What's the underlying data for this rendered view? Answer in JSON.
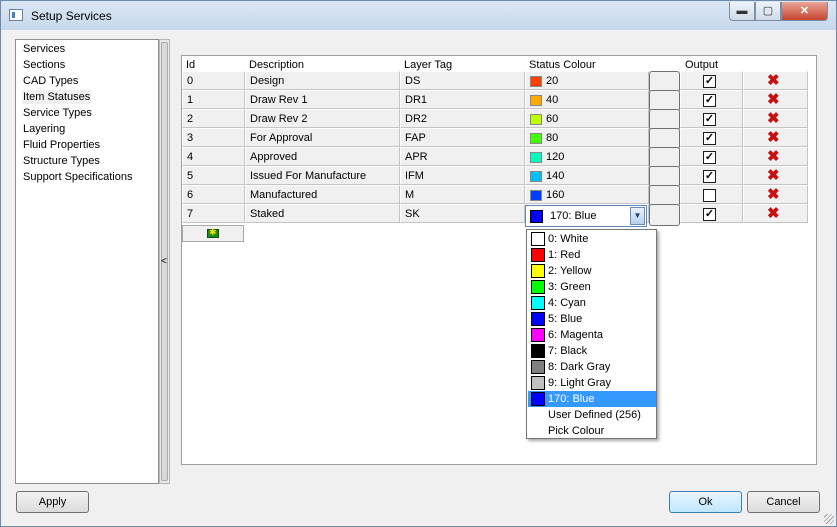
{
  "window": {
    "title": "Setup Services",
    "minimize_glyph": "▬",
    "maximize_glyph": "▢",
    "close_glyph": "✕"
  },
  "nav": {
    "items": [
      {
        "label": "Services"
      },
      {
        "label": "Sections"
      },
      {
        "label": "CAD Types"
      },
      {
        "label": "Item Statuses",
        "selected": true
      },
      {
        "label": "Service Types"
      },
      {
        "label": "Layering"
      },
      {
        "label": "Fluid Properties"
      },
      {
        "label": "Structure Types"
      },
      {
        "label": "Support Specifications"
      }
    ],
    "collapse_glyph": "<"
  },
  "grid": {
    "headers": {
      "id": "Id",
      "description": "Description",
      "layer_tag": "Layer Tag",
      "status_colour": "Status Colour",
      "output": "Output"
    },
    "rows": [
      {
        "id": "0",
        "description": "Design",
        "layer_tag": "DS",
        "colour": "20",
        "swatch": "#ff3f00",
        "output": true
      },
      {
        "id": "1",
        "description": "Draw Rev 1",
        "layer_tag": "DR1",
        "colour": "40",
        "swatch": "#ffaa00",
        "output": true
      },
      {
        "id": "2",
        "description": "Draw Rev 2",
        "layer_tag": "DR2",
        "colour": "60",
        "swatch": "#bfff00",
        "output": true
      },
      {
        "id": "3",
        "description": "For Approval",
        "layer_tag": "FAP",
        "colour": "80",
        "swatch": "#3fff00",
        "output": true
      },
      {
        "id": "4",
        "description": "Approved",
        "layer_tag": "APR",
        "colour": "120",
        "swatch": "#00ffbf",
        "output": true
      },
      {
        "id": "5",
        "description": "Issued For Manufacture",
        "layer_tag": "IFM",
        "colour": "140",
        "swatch": "#00bfff",
        "output": true
      },
      {
        "id": "6",
        "description": "Manufactured",
        "layer_tag": "M",
        "colour": "160",
        "swatch": "#003fff",
        "output": false
      },
      {
        "id": "7",
        "description": "Staked",
        "layer_tag": "SK",
        "colour": "",
        "swatch": "",
        "output": true
      }
    ],
    "check_glyph": "✓",
    "delete_glyph": "✖"
  },
  "status_combo": {
    "value": "170: Blue",
    "swatch": "#0000ff",
    "arrow_glyph": "▼"
  },
  "colour_dropdown": {
    "options": [
      {
        "label": "0: White",
        "swatch": "#ffffff"
      },
      {
        "label": "1: Red",
        "swatch": "#ff0000"
      },
      {
        "label": "2: Yellow",
        "swatch": "#ffff00"
      },
      {
        "label": "3: Green",
        "swatch": "#00ff00"
      },
      {
        "label": "4: Cyan",
        "swatch": "#00ffff"
      },
      {
        "label": "5: Blue",
        "swatch": "#0000ff"
      },
      {
        "label": "6: Magenta",
        "swatch": "#ff00ff"
      },
      {
        "label": "7: Black",
        "swatch": "#000000"
      },
      {
        "label": "8: Dark Gray",
        "swatch": "#808080"
      },
      {
        "label": "9: Light Gray",
        "swatch": "#c0c0c0"
      },
      {
        "label": "170: Blue",
        "swatch": "#0000ff",
        "selected": true
      },
      {
        "label": "User Defined (256)",
        "swatch": ""
      },
      {
        "label": "Pick Colour",
        "swatch": ""
      }
    ]
  },
  "buttons": {
    "apply": "Apply",
    "ok": "Ok",
    "cancel": "Cancel"
  }
}
